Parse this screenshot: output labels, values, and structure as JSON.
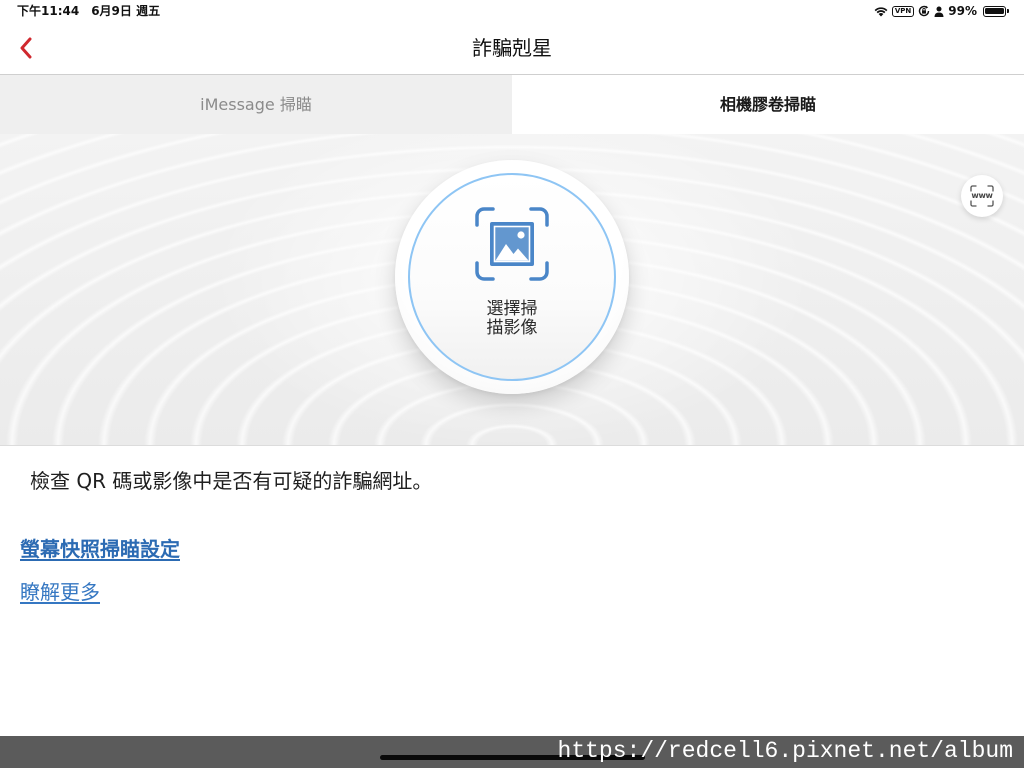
{
  "status_bar": {
    "time": "下午11:44",
    "date": "6月9日 週五",
    "vpn_label": "VPN",
    "battery_text": "99%",
    "battery_level": 99,
    "icons": [
      "wifi-icon",
      "vpn-icon",
      "orientation-lock-icon",
      "person-icon",
      "battery-icon"
    ]
  },
  "nav": {
    "title": "詐騙剋星",
    "back_icon": "chevron-left-icon"
  },
  "tabs": [
    {
      "label": "iMessage 掃瞄",
      "selected": false
    },
    {
      "label": "相機膠卷掃瞄",
      "selected": true
    }
  ],
  "scan": {
    "label_lines": [
      "選擇掃",
      "描影像"
    ],
    "icon": "image-scan-icon",
    "url_scan_label": "www",
    "url_scan_icon": "www-scan-icon"
  },
  "content": {
    "description": "檢查 QR 碼或影像中是否有可疑的詐騙網址。",
    "screenshot_settings_link": "螢幕快照掃瞄設定",
    "learn_more_link": "瞭解更多"
  },
  "watermark": "https://redcell6.pixnet.net/album",
  "theme": {
    "accent": "#d0282e",
    "link": "#2c6bb3",
    "link_secondary": "#3577c2",
    "ring": "#8ec5f4",
    "icon_blue": "#4a86c8"
  }
}
